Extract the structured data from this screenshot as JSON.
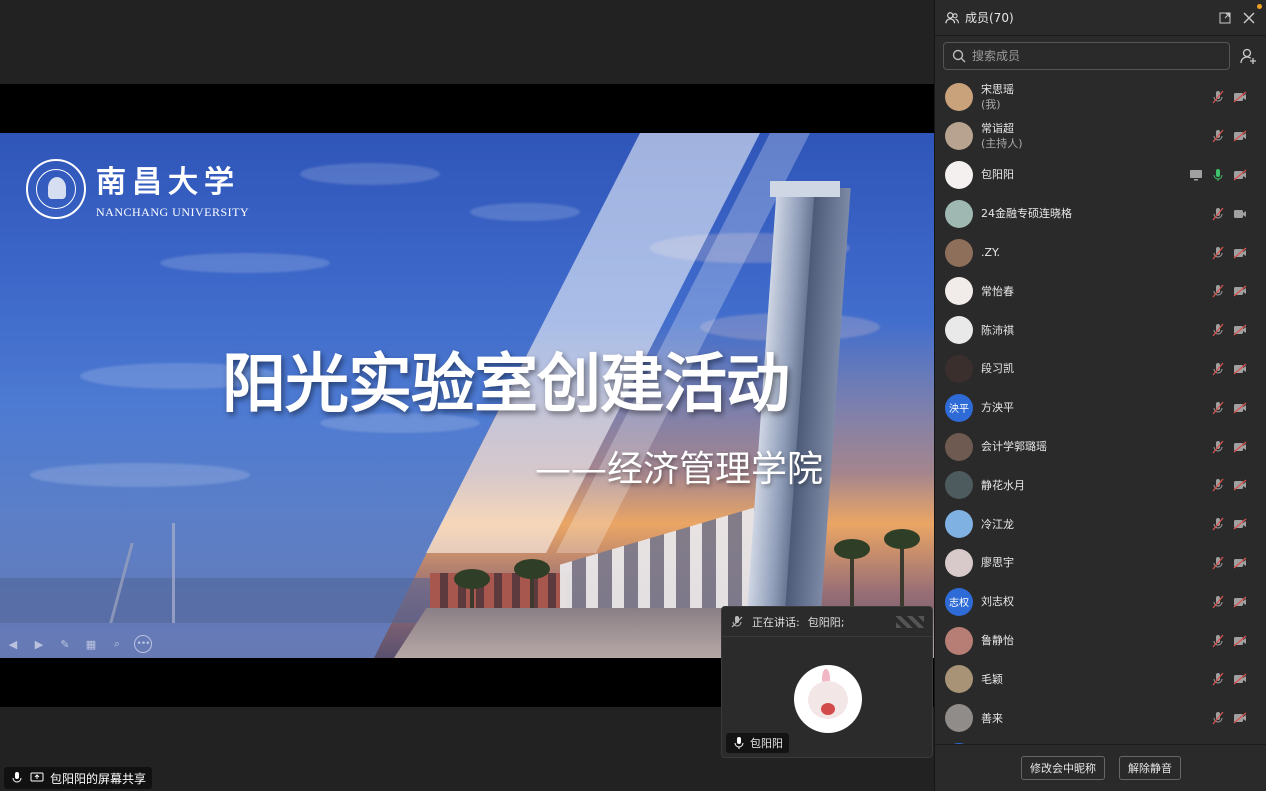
{
  "slide": {
    "logo_cn": "南昌大学",
    "logo_en": "NANCHANG UNIVERSITY",
    "title": "阳光实验室创建活动",
    "subtitle": "——经济管理学院"
  },
  "speaker_window": {
    "label": "正在讲话:",
    "speaker": "包阳阳;",
    "name": "包阳阳"
  },
  "share_status": "包阳阳的屏幕共享",
  "panel": {
    "title": "成员(70)",
    "search_placeholder": "搜索成员",
    "members": [
      {
        "name": "宋思瑶",
        "role": "(我)",
        "avatar_text": "",
        "avatar_color": "#c9a27c",
        "screen": false,
        "mic": "muted",
        "cam": "off"
      },
      {
        "name": "常诣超",
        "role": "(主持人)",
        "avatar_text": "",
        "avatar_color": "#b7a38f",
        "screen": false,
        "mic": "muted",
        "cam": "off"
      },
      {
        "name": "包阳阳",
        "role": "",
        "avatar_text": "",
        "avatar_color": "#f4f0f0",
        "screen": true,
        "mic": "active",
        "cam": "off"
      },
      {
        "name": "24金融专硕连晓格",
        "role": "",
        "avatar_text": "",
        "avatar_color": "#9fb9b2",
        "screen": false,
        "mic": "muted",
        "cam": "on"
      },
      {
        "name": ".ZY.",
        "role": "",
        "avatar_text": "",
        "avatar_color": "#8d6f5a",
        "screen": false,
        "mic": "muted",
        "cam": "off"
      },
      {
        "name": "常怡春",
        "role": "",
        "avatar_text": "",
        "avatar_color": "#f1ece9",
        "screen": false,
        "mic": "muted",
        "cam": "off"
      },
      {
        "name": "陈沛祺",
        "role": "",
        "avatar_text": "",
        "avatar_color": "#e9e9e9",
        "screen": false,
        "mic": "muted",
        "cam": "off"
      },
      {
        "name": "段习凯",
        "role": "",
        "avatar_text": "",
        "avatar_color": "#3a2f2c",
        "screen": false,
        "mic": "muted",
        "cam": "off"
      },
      {
        "name": "方泱平",
        "role": "",
        "avatar_text": "泱平",
        "avatar_color": "#2e6bd6",
        "screen": false,
        "mic": "muted",
        "cam": "off"
      },
      {
        "name": "会计学郭璐瑶",
        "role": "",
        "avatar_text": "",
        "avatar_color": "#6e5a50",
        "screen": false,
        "mic": "muted",
        "cam": "off"
      },
      {
        "name": "静花水月",
        "role": "",
        "avatar_text": "",
        "avatar_color": "#4d5a5e",
        "screen": false,
        "mic": "muted",
        "cam": "off"
      },
      {
        "name": "冷江龙",
        "role": "",
        "avatar_text": "",
        "avatar_color": "#7fb2e3",
        "screen": false,
        "mic": "muted",
        "cam": "off"
      },
      {
        "name": "廖思宇",
        "role": "",
        "avatar_text": "",
        "avatar_color": "#d8c9cb",
        "screen": false,
        "mic": "muted",
        "cam": "off"
      },
      {
        "name": "刘志权",
        "role": "",
        "avatar_text": "志权",
        "avatar_color": "#2e6bd6",
        "screen": false,
        "mic": "muted",
        "cam": "off"
      },
      {
        "name": "鲁静怡",
        "role": "",
        "avatar_text": "",
        "avatar_color": "#b77e76",
        "screen": false,
        "mic": "muted",
        "cam": "off"
      },
      {
        "name": "毛颖",
        "role": "",
        "avatar_text": "",
        "avatar_color": "#a89377",
        "screen": false,
        "mic": "muted",
        "cam": "off"
      },
      {
        "name": "善来",
        "role": "",
        "avatar_text": "",
        "avatar_color": "#8f8c8a",
        "screen": false,
        "mic": "muted",
        "cam": "off"
      },
      {
        "name": "",
        "role": "",
        "avatar_text": "",
        "avatar_color": "#2e6bd6",
        "screen": false,
        "mic": "",
        "cam": ""
      }
    ],
    "footer": {
      "rename_label": "修改会中昵称",
      "unmute_label": "解除静音"
    }
  },
  "colors": {
    "mic_active": "#3fc26b",
    "mic_muted": "#d9534f",
    "icon_gray": "#a0a0a0"
  }
}
